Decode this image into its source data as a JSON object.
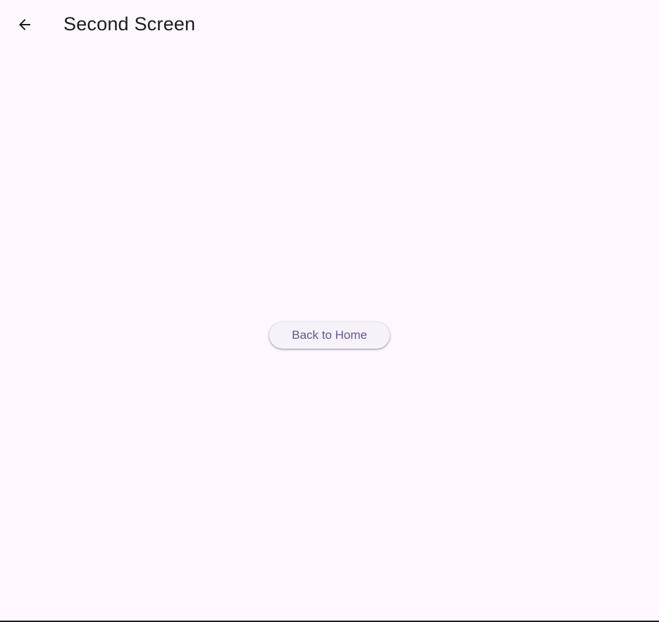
{
  "app_bar": {
    "title": "Second Screen",
    "back_icon": "arrow-back-icon"
  },
  "main": {
    "back_home_label": "Back to Home"
  },
  "colors": {
    "background": "#fef7ff",
    "button_background": "#f7f2fa",
    "button_text": "#65558f",
    "on_surface": "#1d1b20"
  }
}
